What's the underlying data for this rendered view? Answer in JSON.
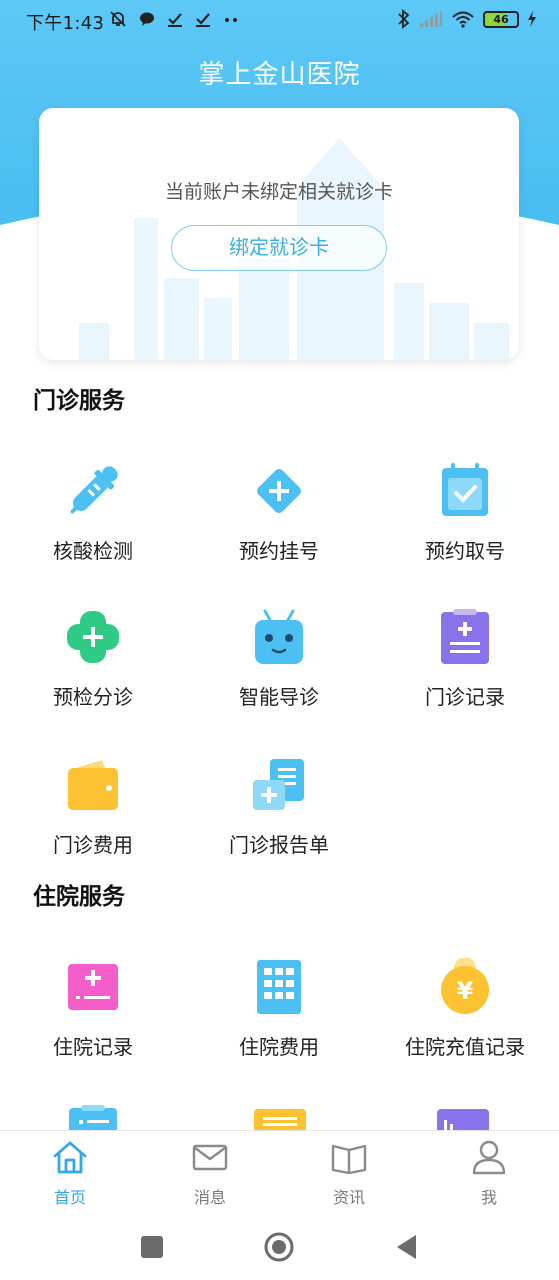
{
  "status_bar": {
    "time": "下午1:43",
    "battery": "46"
  },
  "header": {
    "title": "掌上金山医院"
  },
  "card": {
    "message": "当前账户未绑定相关就诊卡",
    "bind_button": "绑定就诊卡"
  },
  "outpatient": {
    "title": "门诊服务",
    "items": [
      {
        "label": "核酸检测",
        "icon": "test-tube-icon"
      },
      {
        "label": "预约挂号",
        "icon": "plus-diamond-icon"
      },
      {
        "label": "预约取号",
        "icon": "calendar-check-icon"
      },
      {
        "label": "预检分诊",
        "icon": "clover-plus-icon"
      },
      {
        "label": "智能导诊",
        "icon": "robot-icon"
      },
      {
        "label": "门诊记录",
        "icon": "clipboard-icon"
      },
      {
        "label": "门诊费用",
        "icon": "wallet-icon"
      },
      {
        "label": "门诊报告单",
        "icon": "report-cards-icon"
      }
    ]
  },
  "inpatient": {
    "title": "住院服务",
    "items": [
      {
        "label": "住院记录",
        "icon": "record-card-icon"
      },
      {
        "label": "住院费用",
        "icon": "hospital-building-icon"
      },
      {
        "label": "住院充值记录",
        "icon": "yuan-coin-icon"
      }
    ]
  },
  "bottom_nav": [
    {
      "label": "首页",
      "icon": "home-icon",
      "active": true
    },
    {
      "label": "消息",
      "icon": "mail-icon",
      "active": false
    },
    {
      "label": "资讯",
      "icon": "book-icon",
      "active": false
    },
    {
      "label": "我",
      "icon": "user-icon",
      "active": false
    }
  ],
  "colors": {
    "primary": "#4cc0f2",
    "accent": "#32a8e6",
    "green": "#2fcb86",
    "purple": "#8a73ea",
    "yellow": "#fcc232",
    "pink": "#f45ec8"
  }
}
